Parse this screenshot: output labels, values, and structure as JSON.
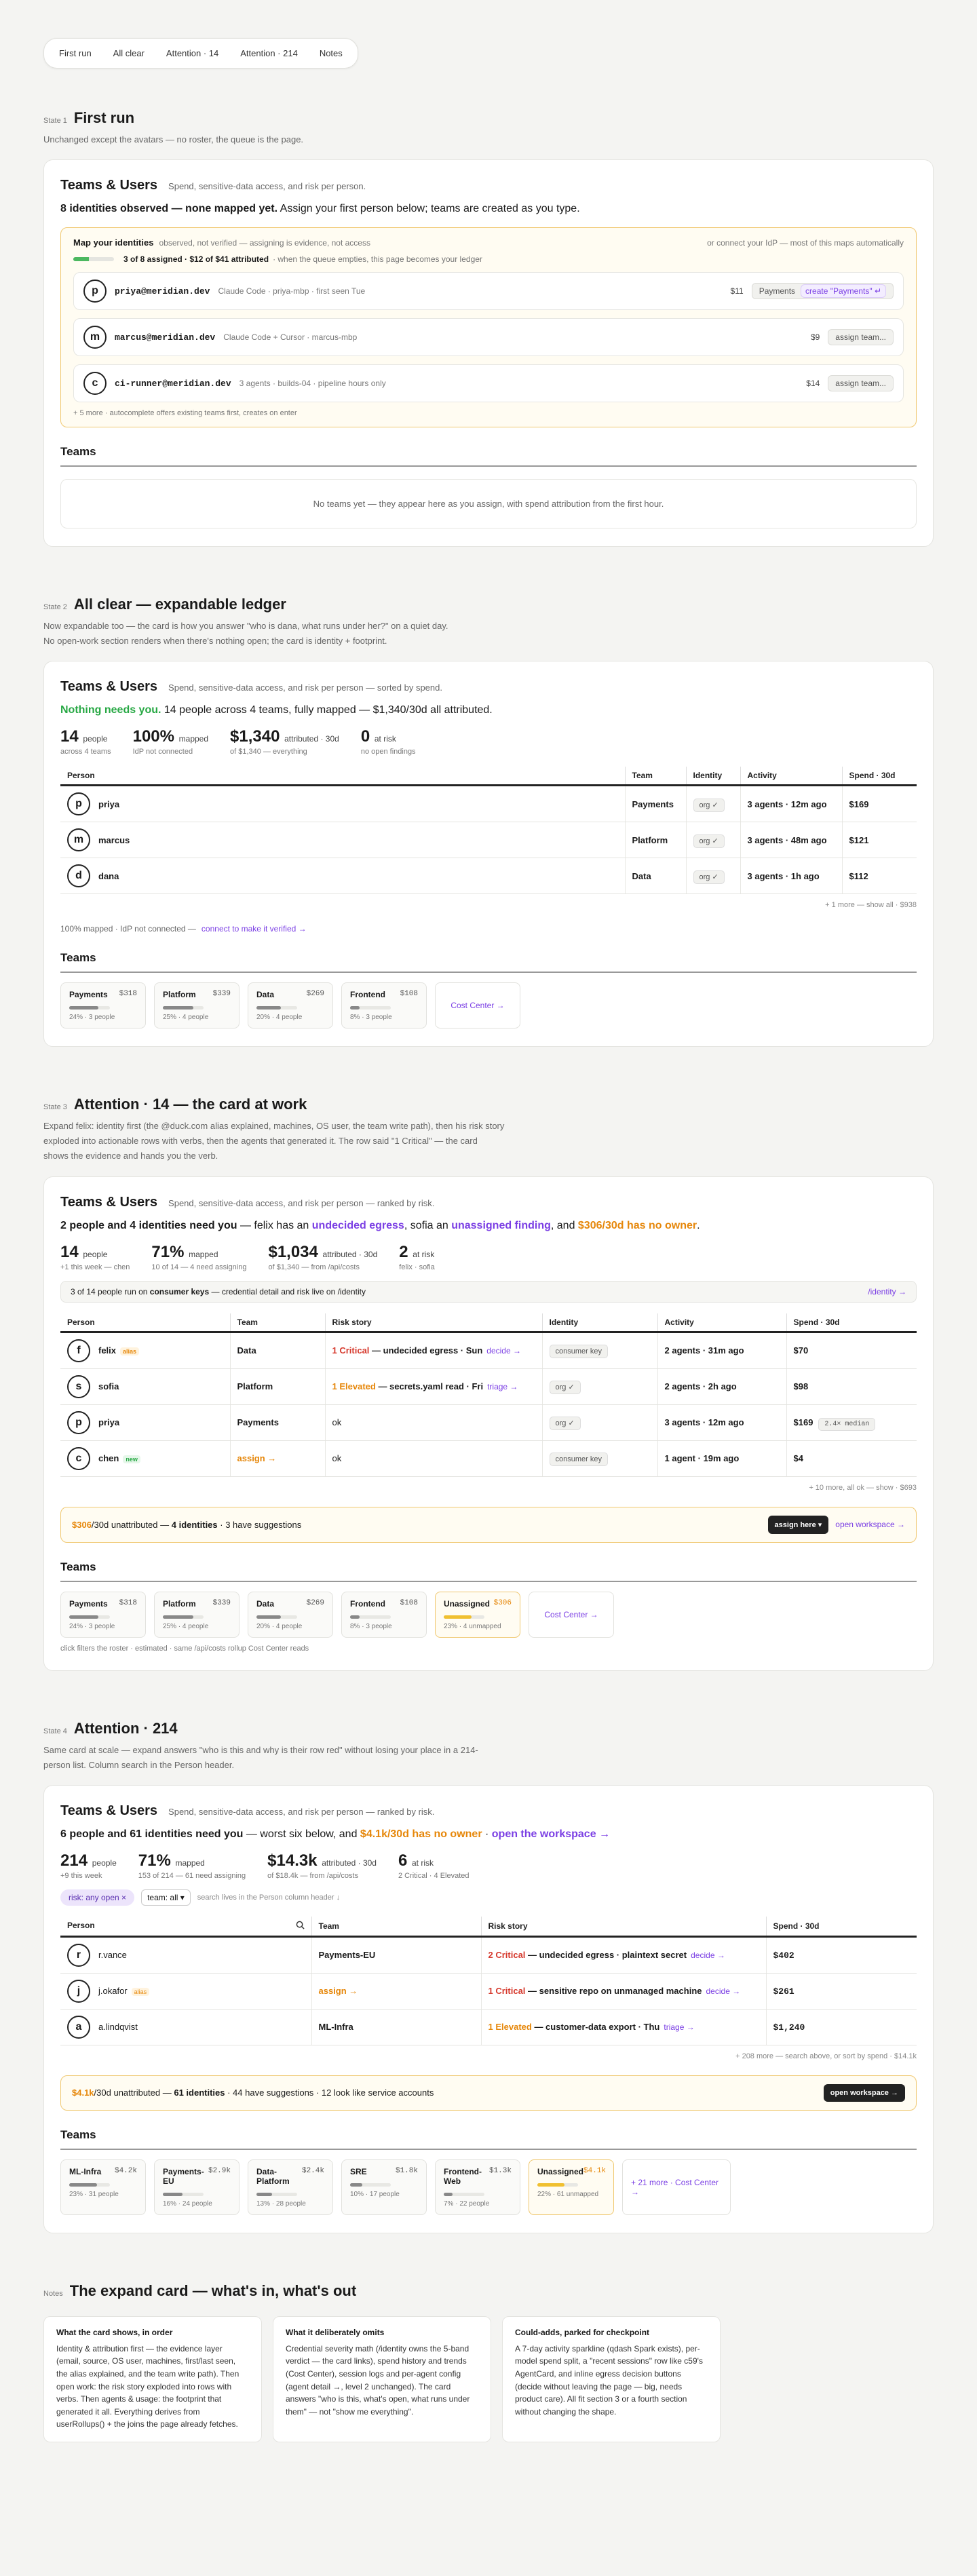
{
  "pills": [
    "First run",
    "All clear",
    "Attention · 14",
    "Attention · 214",
    "Notes"
  ],
  "s1": {
    "tag": "State 1",
    "title": "First run",
    "desc": "Unchanged except the avatars — no roster, the queue is the page.",
    "card_title": "Teams & Users",
    "card_sub": "Spend, sensitive-data access, and risk per person.",
    "headline_b": "8 identities observed — none mapped yet.",
    "headline_rest": " Assign your first person below; teams are created as you type.",
    "map_title": "Map your identities",
    "map_note": "observed, not verified — assigning is evidence, not access",
    "map_right": "or connect your IdP — most of this maps automatically",
    "progress_text": "3 of 8 assigned · $12 of $41 attributed",
    "progress_note": "· when the queue empties, this page becomes your ledger",
    "progress_pct": 37.5,
    "rows": [
      {
        "initial": "p",
        "email": "priya@meridian.dev",
        "meta": "Claude Code · priya-mbp · first seen Tue",
        "spend": "$11",
        "action1": "Payments",
        "action2": "create \"Payments\" ↵"
      },
      {
        "initial": "m",
        "email": "marcus@meridian.dev",
        "meta": "Claude Code + Cursor · marcus-mbp",
        "spend": "$9",
        "action1": "assign team..."
      },
      {
        "initial": "c",
        "email": "ci-runner@meridian.dev",
        "meta": "3 agents · builds-04 · pipeline hours only",
        "spend": "$14",
        "action1": "assign team..."
      }
    ],
    "map_foot": "+ 5 more · autocomplete offers existing teams first, creates on enter",
    "teams_h": "Teams",
    "empty": "No teams yet — they appear here as you assign, with spend attribution from the first hour."
  },
  "s2": {
    "tag": "State 2",
    "title": "All clear — expandable ledger",
    "desc1": "Now expandable too — the card is how you answer \"who is dana, what runs under her?\" on a quiet day.",
    "desc2": "No open-work section renders when there's nothing open; the card is identity + footprint.",
    "card_title": "Teams & Users",
    "card_sub": "Spend, sensitive-data access, and risk per person — sorted by spend.",
    "headline_g": "Nothing needs you.",
    "headline_rest": " 14 people across 4 teams, fully mapped — $1,340/30d all attributed.",
    "stats": [
      {
        "n": "14",
        "u": "people",
        "d": "across 4 teams",
        "dc": ""
      },
      {
        "n": "100%",
        "u": "mapped",
        "d": "IdP not connected",
        "dc": "green"
      },
      {
        "n": "$1,340",
        "u": "attributed · 30d",
        "d": "of $1,340 — everything",
        "dc": ""
      },
      {
        "n": "0",
        "u": "at risk",
        "d": "no open findings",
        "dc": "green"
      }
    ],
    "cols": [
      "Person",
      "Team",
      "Identity",
      "Activity",
      "Spend · 30d"
    ],
    "rows": [
      {
        "initial": "p",
        "name": "priya",
        "team": "Payments",
        "identity": "org ✓",
        "activity": "3 agents · 12m ago",
        "spend": "$169"
      },
      {
        "initial": "m",
        "name": "marcus",
        "team": "Platform",
        "identity": "org ✓",
        "activity": "3 agents · 48m ago",
        "spend": "$121"
      },
      {
        "initial": "d",
        "name": "dana",
        "team": "Data",
        "identity": "org ✓",
        "activity": "3 agents · 1h ago",
        "spend": "$112"
      }
    ],
    "foot": "+ 1 more — show all · $938",
    "mapped": "100% mapped · IdP not connected —",
    "mapped_link": "connect to make it verified →",
    "teams_h": "Teams",
    "tiles": [
      {
        "name": "Payments",
        "amt": "$318",
        "sub": "24% · 3 people",
        "pct": 24
      },
      {
        "name": "Platform",
        "amt": "$339",
        "sub": "25% · 4 people",
        "pct": 25
      },
      {
        "name": "Data",
        "amt": "$269",
        "sub": "20% · 4 people",
        "pct": 20
      },
      {
        "name": "Frontend",
        "amt": "$108",
        "sub": "8% · 3 people",
        "pct": 8
      }
    ],
    "cost_center": "Cost Center →"
  },
  "s3": {
    "tag": "State 3",
    "title": "Attention · 14 — the card at work",
    "desc": "Expand felix: identity first (the @duck.com alias explained, machines, OS user, the team write path), then his risk story exploded into actionable rows with verbs, then the agents that generated it. The row said \"1 Critical\" — the card shows the evidence and hands you the verb.",
    "card_title": "Teams & Users",
    "card_sub": "Spend, sensitive-data access, and risk per person — ranked by risk.",
    "h1": "2 people and 4 identities need you",
    "h2": " — felix has an ",
    "h3": "undecided egress",
    "h4": ", sofia an ",
    "h5": "unassigned finding",
    "h6": ", and ",
    "h7": "$306/30d has no owner",
    "h8": ".",
    "stats": [
      {
        "n": "14",
        "u": "people",
        "d": "+1 this week — chen",
        "dc": "green"
      },
      {
        "n": "71%",
        "u": "mapped",
        "d": "10 of 14 — 4 need assigning",
        "dc": "orange"
      },
      {
        "n": "$1,034",
        "u": "attributed · 30d",
        "d": "of $1,340 — from /api/costs",
        "dc": ""
      },
      {
        "n": "2",
        "u": "at risk",
        "d": "felix · sofia",
        "dc": "red"
      }
    ],
    "notebar": "3 of 14 people run on consumer keys — credential detail and risk live on /identity",
    "notebar_b": "consumer keys",
    "notebar_link": "/identity →",
    "cols": [
      "Person",
      "Team",
      "Risk story",
      "Identity",
      "Activity",
      "Spend · 30d"
    ],
    "rows": [
      {
        "initial": "f",
        "name": "felix",
        "badge": "alias",
        "badge_c": "o",
        "team": "Data",
        "sev": "1 Critical",
        "sev_c": "red",
        "story": " — undecided egress · Sun",
        "verb": "decide →",
        "identity": "consumer key",
        "activity": "2 agents · 31m ago",
        "spend": "$70",
        "extra": ""
      },
      {
        "initial": "s",
        "name": "sofia",
        "badge": "",
        "badge_c": "",
        "team": "Platform",
        "sev": "1 Elevated",
        "sev_c": "orange",
        "story": " — secrets.yaml read · Fri",
        "verb": "triage →",
        "identity": "org ✓",
        "activity": "2 agents · 2h ago",
        "spend": "$98",
        "extra": ""
      },
      {
        "initial": "p",
        "name": "priya",
        "badge": "",
        "badge_c": "",
        "team": "Payments",
        "sev": "",
        "sev_c": "",
        "story": "ok",
        "verb": "",
        "identity": "org ✓",
        "activity": "3 agents · 12m ago",
        "spend": "$169",
        "extra": "2.4× median"
      },
      {
        "initial": "c",
        "name": "chen",
        "badge": "new",
        "badge_c": "g",
        "team": "assign →",
        "sev": "",
        "sev_c": "",
        "story": "ok",
        "verb": "",
        "identity": "consumer key",
        "activity": "1 agent · 19m ago",
        "spend": "$4",
        "extra": ""
      }
    ],
    "foot": "+ 10 more, all ok — show · $693",
    "unattr_a": "$306",
    "unattr_b": "/30d unattributed — ",
    "unattr_c": "4 identities",
    "unattr_d": " · 3 have suggestions",
    "btn": "assign here ▾",
    "link": "open workspace →",
    "teams_h": "Teams",
    "tiles": [
      {
        "name": "Payments",
        "amt": "$318",
        "sub": "24% · 3 people",
        "pct": 24
      },
      {
        "name": "Platform",
        "amt": "$339",
        "sub": "25% · 4 people",
        "pct": 25
      },
      {
        "name": "Data",
        "amt": "$269",
        "sub": "20% · 4 people",
        "pct": 20
      },
      {
        "name": "Frontend",
        "amt": "$108",
        "sub": "8% · 3 people",
        "pct": 8
      }
    ],
    "unassigned": {
      "name": "Unassigned",
      "amt": "$306",
      "sub": "23% · 4 unmapped",
      "pct": 23
    },
    "cost_center": "Cost Center →",
    "tiles_foot": "click filters the roster · estimated · same /api/costs rollup Cost Center reads"
  },
  "s4": {
    "tag": "State 4",
    "title": "Attention · 214",
    "desc": "Same card at scale — expand answers \"who is this and why is their row red\" without losing your place in a 214-person list. Column search in the Person header.",
    "card_title": "Teams & Users",
    "card_sub": "Spend, sensitive-data access, and risk per person — ranked by risk.",
    "h1": "6 people and 61 identities need you",
    "h2": " — worst six below, and ",
    "h3": "$4.1k/30d has no owner",
    "h4": " · ",
    "h5": "open the workspace →",
    "stats": [
      {
        "n": "214",
        "u": "people",
        "d": "+9 this week",
        "dc": "green"
      },
      {
        "n": "71%",
        "u": "mapped",
        "d": "153 of 214 — 61 need assigning",
        "dc": "orange"
      },
      {
        "n": "$14.3k",
        "u": "attributed · 30d",
        "d": "of $18.4k — from /api/costs",
        "dc": ""
      },
      {
        "n": "6",
        "u": "at risk",
        "d": "2 Critical · 4 Elevated",
        "dc": "red"
      }
    ],
    "filter1": "risk: any open  ×",
    "filter2": "team: all ▾",
    "filter_note": "search lives in the Person column header ↓",
    "cols": [
      "Person",
      "Team",
      "Risk story",
      "Spend · 30d"
    ],
    "rows": [
      {
        "initial": "r",
        "name": "r.vance",
        "badge": "",
        "team": "Payments-EU",
        "team_c": "",
        "sev": "2 Critical",
        "sev_c": "red",
        "story": " — undecided egress · plaintext secret",
        "verb": "decide →",
        "spend": "$402"
      },
      {
        "initial": "j",
        "name": "j.okafor",
        "badge": "alias",
        "team": "assign →",
        "team_c": "orange",
        "sev": "1 Critical",
        "sev_c": "red",
        "story": " — sensitive repo on unmanaged machine",
        "verb": "decide →",
        "spend": "$261"
      },
      {
        "initial": "a",
        "name": "a.lindqvist",
        "badge": "",
        "team": "ML-Infra",
        "team_c": "",
        "sev": "1 Elevated",
        "sev_c": "orange",
        "story": " — customer-data export · Thu",
        "verb": "triage →",
        "spend": "$1,240"
      }
    ],
    "foot": "+ 208 more — search above, or sort by spend · $14.1k",
    "unattr_a": "$4.1k",
    "unattr_b": "/30d unattributed — ",
    "unattr_c": "61 identities",
    "unattr_d": " · 44 have suggestions · 12 look like service accounts",
    "btn": "open workspace →",
    "teams_h": "Teams",
    "tiles": [
      {
        "name": "ML-Infra",
        "amt": "$4.2k",
        "sub": "23% · 31 people",
        "pct": 23
      },
      {
        "name": "Payments-EU",
        "amt": "$2.9k",
        "sub": "16% · 24 people",
        "pct": 16
      },
      {
        "name": "Data-Platform",
        "amt": "$2.4k",
        "sub": "13% · 28 people",
        "pct": 13
      },
      {
        "name": "SRE",
        "amt": "$1.8k",
        "sub": "10% · 17 people",
        "pct": 10
      },
      {
        "name": "Frontend-Web",
        "amt": "$1.3k",
        "sub": "7% · 22 people",
        "pct": 7
      }
    ],
    "unassigned": {
      "name": "Unassigned",
      "amt": "$4.1k",
      "sub": "22% · 61 unmapped",
      "pct": 22
    },
    "cost_center": "+ 21 more · Cost Center →"
  },
  "notes": {
    "tag": "Notes",
    "title": "The expand card — what's in, what's out",
    "cards": [
      {
        "h": "What the card shows, in order",
        "p": "Identity & attribution first — the evidence layer (email, source, OS user, machines, first/last seen, the alias explained, and the team write path). Then open work: the risk story exploded into rows with verbs. Then agents & usage: the footprint that generated it all. Everything derives from userRollups() + the joins the page already fetches."
      },
      {
        "h": "What it deliberately omits",
        "p": "Credential severity math (/identity owns the 5-band verdict — the card links), spend history and trends (Cost Center), session logs and per-agent config (agent detail →, level 2 unchanged). The card answers \"who is this, what's open, what runs under them\" — not \"show me everything\"."
      },
      {
        "h": "Could-adds, parked for checkpoint",
        "p": "A 7-day activity sparkline (qdash Spark exists), per-model spend split, a \"recent sessions\" row like c59's AgentCard, and inline egress decision buttons (decide without leaving the page — big, needs product care). All fit section 3 or a fourth section without changing the shape."
      }
    ]
  }
}
